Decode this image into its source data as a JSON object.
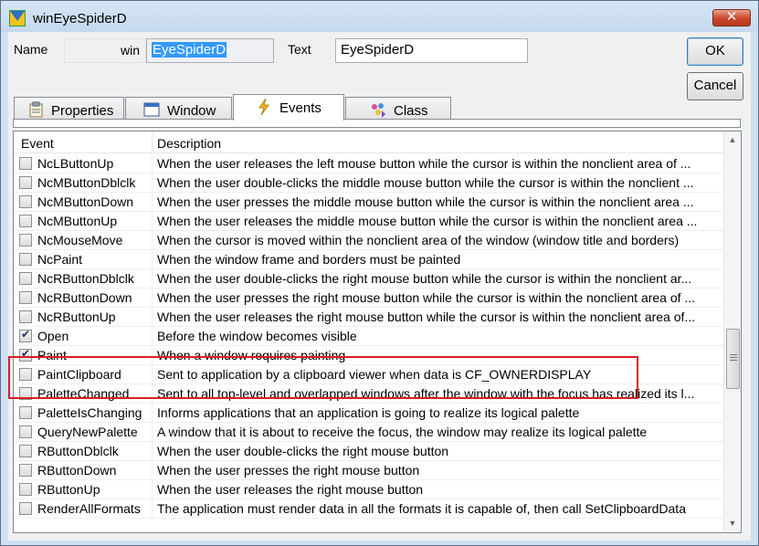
{
  "window": {
    "title": "winEyeSpiderD",
    "close_glyph": "✕"
  },
  "fields": {
    "name_label": "Name",
    "name_prefix": "win",
    "name_value": "EyeSpiderD",
    "text_label": "Text",
    "text_value": "EyeSpiderD"
  },
  "buttons": {
    "ok": "OK",
    "cancel": "Cancel"
  },
  "tabs": [
    {
      "label": "Properties",
      "icon": "properties-icon"
    },
    {
      "label": "Window",
      "icon": "window-icon"
    },
    {
      "label": "Events",
      "icon": "lightning-icon",
      "active": true
    },
    {
      "label": "Class",
      "icon": "class-icon"
    }
  ],
  "list": {
    "headers": {
      "event": "Event",
      "description": "Description"
    },
    "rows": [
      {
        "event": "NcLButtonUp",
        "checked": false,
        "description": "When the user releases the left mouse button while the cursor is within the nonclient area of ..."
      },
      {
        "event": "NcMButtonDblclk",
        "checked": false,
        "description": "When the user double-clicks the middle mouse button while the cursor is within the nonclient ..."
      },
      {
        "event": "NcMButtonDown",
        "checked": false,
        "description": "When the user presses the middle mouse button while the cursor is within the nonclient area ..."
      },
      {
        "event": "NcMButtonUp",
        "checked": false,
        "description": "When the user releases the middle mouse button while the cursor is within the nonclient area ..."
      },
      {
        "event": "NcMouseMove",
        "checked": false,
        "description": "When the cursor is moved within the nonclient area of the window (window title and borders)"
      },
      {
        "event": "NcPaint",
        "checked": false,
        "description": "When the window frame and borders must be painted"
      },
      {
        "event": "NcRButtonDblclk",
        "checked": false,
        "description": "When the user double-clicks the right mouse button while the cursor is within the nonclient ar..."
      },
      {
        "event": "NcRButtonDown",
        "checked": false,
        "description": "When the user presses the right mouse button while the cursor is within the nonclient area of ..."
      },
      {
        "event": "NcRButtonUp",
        "checked": false,
        "description": "When the user releases the right mouse button while the cursor is within the nonclient area of..."
      },
      {
        "event": "Open",
        "checked": true,
        "description": "Before the window becomes visible"
      },
      {
        "event": "Paint",
        "checked": true,
        "description": "When a window requires painting"
      },
      {
        "event": "PaintClipboard",
        "checked": false,
        "description": "Sent to application by a clipboard viewer when data is CF_OWNERDISPLAY"
      },
      {
        "event": "PaletteChanged",
        "checked": false,
        "description": "Sent to all top-level and overlapped windows after the window with the focus has realized its l..."
      },
      {
        "event": "PaletteIsChanging",
        "checked": false,
        "description": "Informs applications that an application is going to realize its logical palette"
      },
      {
        "event": "QueryNewPalette",
        "checked": false,
        "description": "A window that it is about to receive the focus, the window may realize its logical palette"
      },
      {
        "event": "RButtonDblclk",
        "checked": false,
        "description": "When the user double-clicks the right mouse button"
      },
      {
        "event": "RButtonDown",
        "checked": false,
        "description": "When the user presses the right mouse button"
      },
      {
        "event": "RButtonUp",
        "checked": false,
        "description": "When the user releases the right mouse button"
      },
      {
        "event": "RenderAllFormats",
        "checked": false,
        "description": "The application must render data in all the formats it is capable of, then call SetClipboardData"
      }
    ]
  },
  "colors": {
    "highlight_box": "#d81f26",
    "selection": "#3399ff"
  }
}
